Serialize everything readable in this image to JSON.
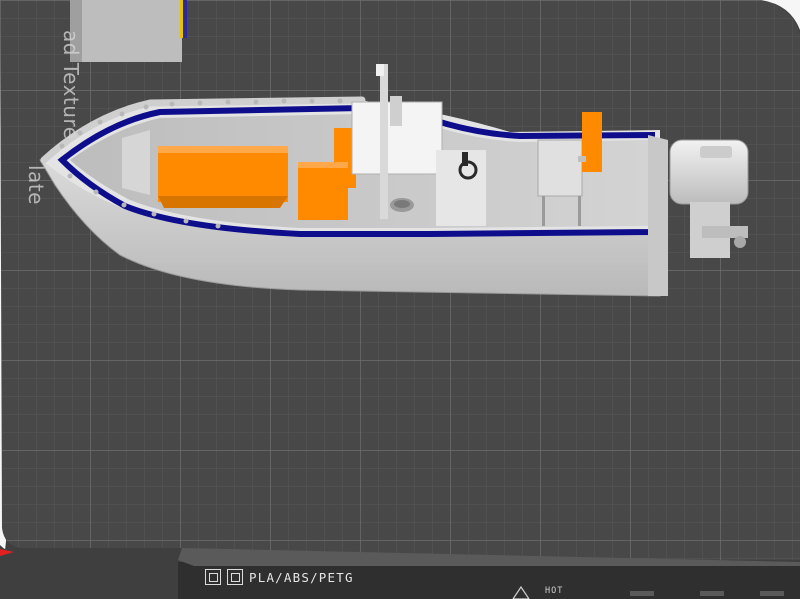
{
  "plate": {
    "label_line_1": "ad Texture",
    "label_line_2": "late",
    "material": "PLA/ABS/PETG",
    "hot_label": "HOT"
  },
  "icons": {
    "material_icons": [
      "corner-brackets-icon",
      "nested-square-icon"
    ],
    "warning": "hot-warning-icon",
    "axis_marker": "x-axis-marker-icon"
  },
  "colors": {
    "plate": "#4a4a4a",
    "grid_line": "#6a6a6a",
    "hull": "#cfcfcf",
    "gunwale_stripe": "#0e0e8c",
    "seat_cushion": "#ff8a00",
    "axis_red": "#e22020"
  }
}
